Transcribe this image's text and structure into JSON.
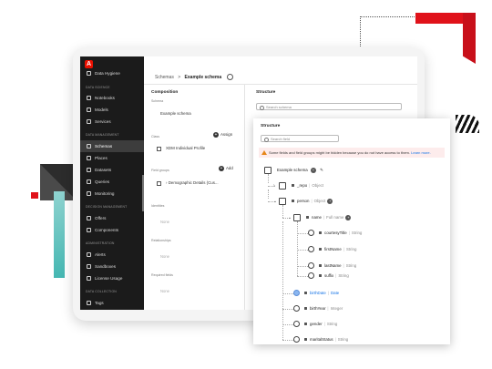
{
  "sidebar": {
    "logo": "A",
    "items_top": [
      {
        "label": "Data Hygiene"
      }
    ],
    "sections": [
      {
        "title": "DATA SCIENCE",
        "items": [
          "Notebooks",
          "Models",
          "Services"
        ]
      },
      {
        "title": "DATA MANAGEMENT",
        "items": [
          "Schemas",
          "Places",
          "Datasets",
          "Queries",
          "Monitoring"
        ]
      },
      {
        "title": "DECISION MANAGEMENT",
        "items": [
          "Offers",
          "Components"
        ]
      },
      {
        "title": "ADMINISTRATION",
        "items": [
          "Alerts",
          "Sandboxes",
          "License Usage"
        ]
      },
      {
        "title": "DATA COLLECTION",
        "items": [
          "Tags"
        ]
      }
    ],
    "active": "Schemas"
  },
  "breadcrumb": {
    "parent": "Schemas",
    "separator": ">",
    "current": "Example schema"
  },
  "composition": {
    "title": "Composition",
    "schema_label": "Schema",
    "schema_value": "Example schema",
    "class_label": "Class",
    "assign_label": "Assign",
    "class_value": "XDM Individual Profile",
    "fieldgroups_label": "Field groups",
    "add_label": "Add",
    "fieldgroup_value": "Demographic Details (Cus...",
    "identities_label": "Identities",
    "identities_value": "None",
    "relationships_label": "Relationships",
    "relationships_value": "None",
    "required_label": "Required fields",
    "required_value": "None"
  },
  "structure_panel": {
    "title": "Structure",
    "search_placeholder": "Search schema"
  },
  "popup": {
    "title": "Structure",
    "search_placeholder": "Search field",
    "warning": "Some fields and field groups might be hidden because you do not have access to them.",
    "warning_link": "Learn more.",
    "root": "Example schema",
    "nodes": [
      {
        "name": "_repo",
        "type": "Object"
      },
      {
        "name": "person",
        "type": "Object"
      },
      {
        "name": "name",
        "type": "Full name"
      },
      {
        "name": "courtesyTitle",
        "type": "String"
      },
      {
        "name": "firstName",
        "type": "String"
      },
      {
        "name": "lastName",
        "type": "String"
      },
      {
        "name": "suffix",
        "type": "String"
      },
      {
        "name": "birthDate",
        "type": "Date"
      },
      {
        "name": "birthYear",
        "type": "Integer"
      },
      {
        "name": "gender",
        "type": "String"
      },
      {
        "name": "maritalStatus",
        "type": "String"
      }
    ]
  },
  "colors": {
    "accent": "#eb1000",
    "link": "#1473e6",
    "sidebar_bg": "#1b1b1b",
    "warning_bg": "#fdecec"
  }
}
